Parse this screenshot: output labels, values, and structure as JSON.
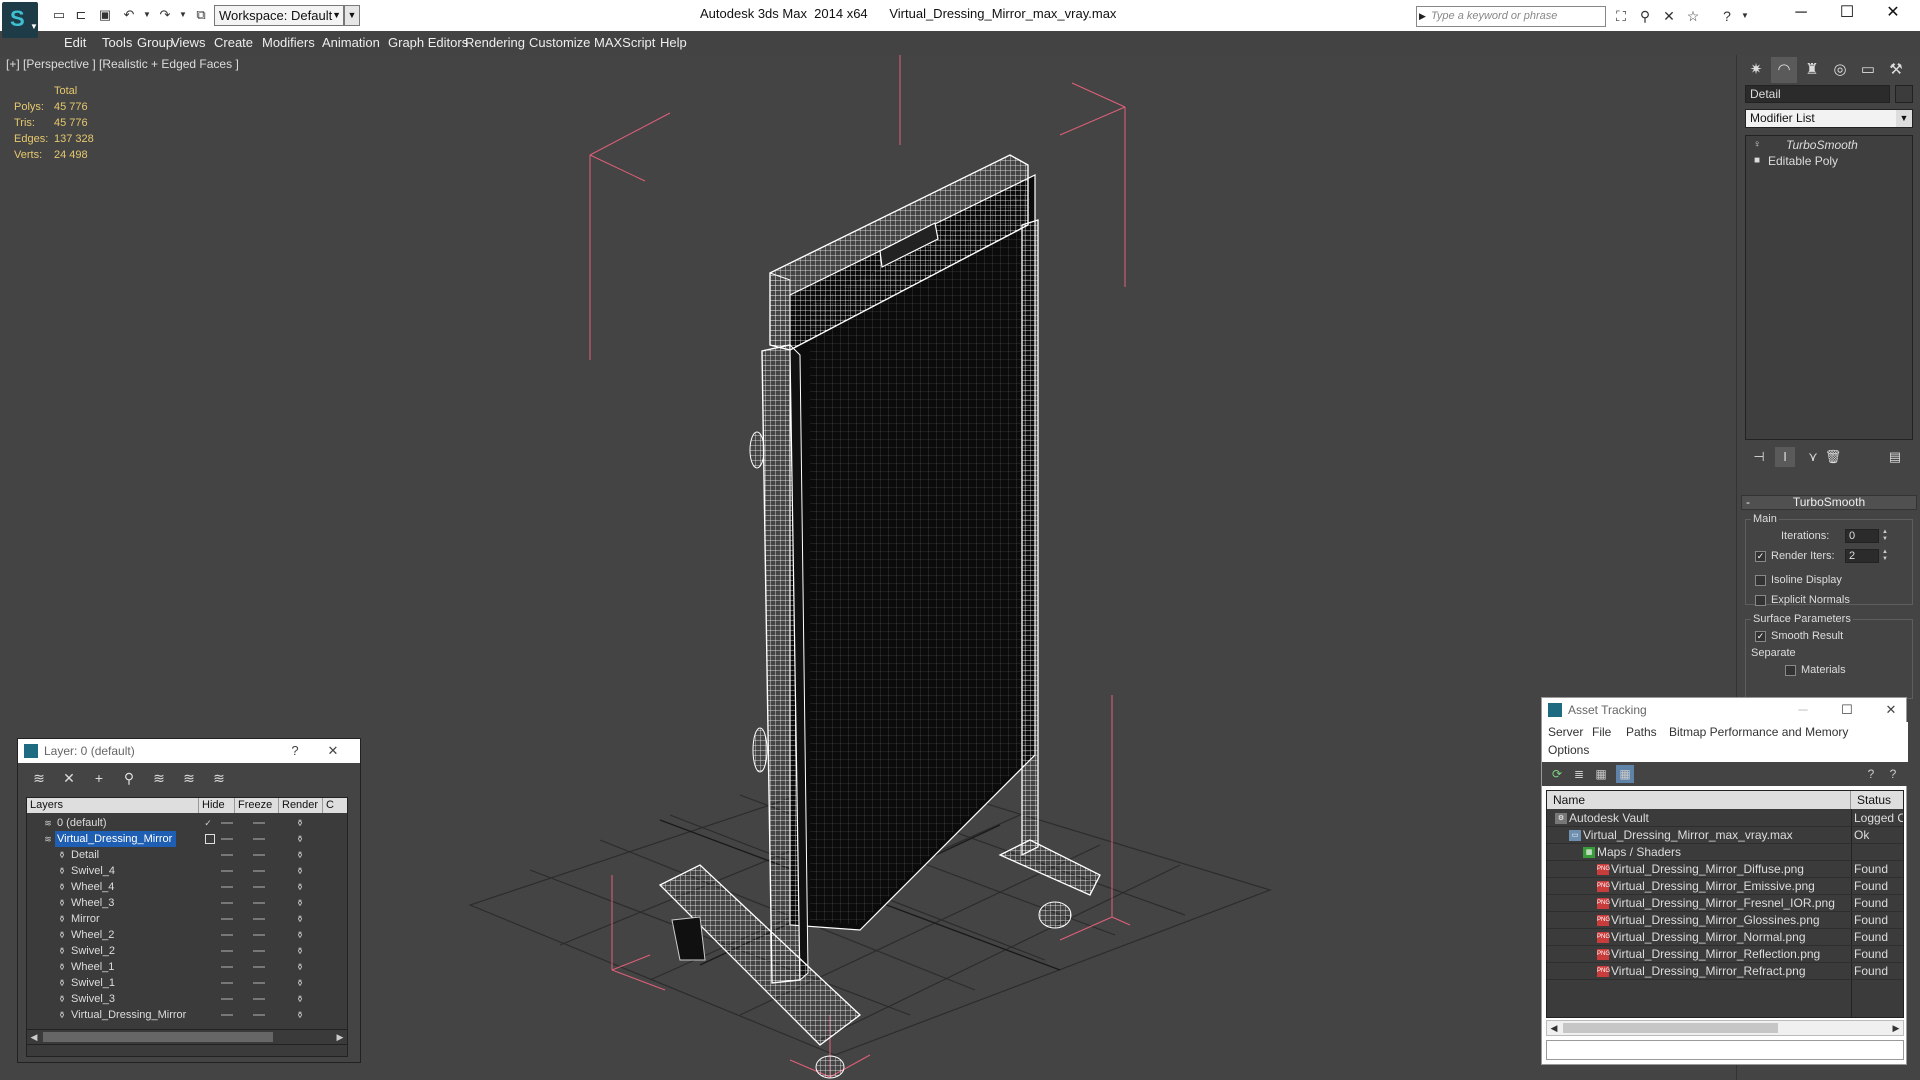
{
  "titlebar": {
    "workspace": "Workspace: Default",
    "app_title": "Autodesk 3ds Max  2014 x64",
    "file_title": "Virtual_Dressing_Mirror_max_vray.max",
    "search_placeholder": "Type a keyword or phrase",
    "window_controls": [
      "minimize-icon",
      "maximize-icon",
      "close-icon"
    ]
  },
  "menu": [
    "Edit",
    "Tools",
    "Group",
    "Views",
    "Create",
    "Modifiers",
    "Animation",
    "Graph Editors",
    "Rendering",
    "Customize",
    "MAXScript",
    "Help"
  ],
  "viewport": {
    "label": "[+] [Perspective ] [Realistic + Edged Faces ]",
    "stats": {
      "header": "Total",
      "rows": [
        {
          "k": "Polys:",
          "v": "45 776"
        },
        {
          "k": "Tris:",
          "v": "45 776"
        },
        {
          "k": "Edges:",
          "v": "137 328"
        },
        {
          "k": "Verts:",
          "v": "24 498"
        }
      ]
    }
  },
  "command_panel": {
    "object_name": "Detail",
    "modifier_list": "Modifier List",
    "stack": [
      {
        "label": "TurboSmooth",
        "italic": true
      },
      {
        "label": "Editable Poly",
        "italic": false
      }
    ],
    "turbosmooth": {
      "title": "TurboSmooth",
      "main": "Main",
      "iterations_label": "Iterations:",
      "iterations_value": "0",
      "render_iters_label": "Render Iters:",
      "render_iters_value": "2",
      "render_iters_checked": true,
      "isoline": "Isoline Display",
      "explicit_normals": "Explicit Normals",
      "surface_params": "Surface Parameters",
      "smooth_result": "Smooth Result",
      "separate": "Separate",
      "materials": "Materials"
    }
  },
  "layer_window": {
    "title": "Layer: 0 (default)",
    "help": "?",
    "columns": [
      "Layers",
      "Hide",
      "Freeze",
      "Render",
      "C"
    ],
    "rows": [
      {
        "name": "0 (default)",
        "level": 0,
        "type": "layer",
        "current": true
      },
      {
        "name": "Virtual_Dressing_Mirror",
        "level": 0,
        "type": "layer",
        "selected": true
      },
      {
        "name": "Detail",
        "level": 1,
        "type": "object"
      },
      {
        "name": "Swivel_4",
        "level": 1,
        "type": "object"
      },
      {
        "name": "Wheel_4",
        "level": 1,
        "type": "object"
      },
      {
        "name": "Wheel_3",
        "level": 1,
        "type": "object"
      },
      {
        "name": "Mirror",
        "level": 1,
        "type": "object"
      },
      {
        "name": "Wheel_2",
        "level": 1,
        "type": "object"
      },
      {
        "name": "Swivel_2",
        "level": 1,
        "type": "object"
      },
      {
        "name": "Wheel_1",
        "level": 1,
        "type": "object"
      },
      {
        "name": "Swivel_1",
        "level": 1,
        "type": "object"
      },
      {
        "name": "Swivel_3",
        "level": 1,
        "type": "object"
      },
      {
        "name": "Virtual_Dressing_Mirror",
        "level": 1,
        "type": "object"
      }
    ]
  },
  "asset_window": {
    "title": "Asset Tracking",
    "menu": [
      "Server",
      "File",
      "Paths",
      "Bitmap Performance and Memory"
    ],
    "menu2": "Options",
    "columns": [
      "Name",
      "Status"
    ],
    "rows": [
      {
        "name": "Autodesk Vault",
        "status": "Logged Out",
        "level": 0,
        "icon": "vault-icon"
      },
      {
        "name": "Virtual_Dressing_Mirror_max_vray.max",
        "status": "Ok",
        "level": 1,
        "icon": "max-file-icon"
      },
      {
        "name": "Maps / Shaders",
        "status": "",
        "level": 2,
        "icon": "maps-icon"
      },
      {
        "name": "Virtual_Dressing_Mirror_Diffuse.png",
        "status": "Found",
        "level": 3,
        "icon": "png-icon"
      },
      {
        "name": "Virtual_Dressing_Mirror_Emissive.png",
        "status": "Found",
        "level": 3,
        "icon": "png-icon"
      },
      {
        "name": "Virtual_Dressing_Mirror_Fresnel_IOR.png",
        "status": "Found",
        "level": 3,
        "icon": "png-icon"
      },
      {
        "name": "Virtual_Dressing_Mirror_Glossines.png",
        "status": "Found",
        "level": 3,
        "icon": "png-icon"
      },
      {
        "name": "Virtual_Dressing_Mirror_Normal.png",
        "status": "Found",
        "level": 3,
        "icon": "png-icon"
      },
      {
        "name": "Virtual_Dressing_Mirror_Reflection.png",
        "status": "Found",
        "level": 3,
        "icon": "png-icon"
      },
      {
        "name": "Virtual_Dressing_Mirror_Refract.png",
        "status": "Found",
        "level": 3,
        "icon": "png-icon"
      }
    ]
  },
  "colors": {
    "viewport_bg": "#444444",
    "stats_text": "#e6c86e",
    "selection": "#1f5fb3",
    "wireframe": "#ffffff",
    "bbox_brackets": "#e0607a"
  }
}
